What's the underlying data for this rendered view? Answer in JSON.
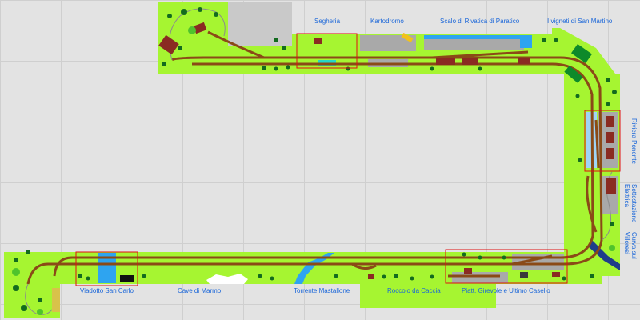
{
  "colors": {
    "board": "#a6f531",
    "track": "#8a4a17",
    "label": "#1a66d9",
    "section_frame": "#e01010",
    "water": "#2ea4f0",
    "building": "#8a2b22",
    "tree": "#136b1f",
    "concrete": "#a9a9a9"
  },
  "labels": {
    "segheria": "Segheria",
    "kartodromo": "Kartodromo",
    "scalo": "Scalo di Rivatica di Paratico",
    "vigneti": "I vigneti di San Martino",
    "riviera": "Riviera Ponente",
    "sottostazione": "Sottostazione Elettrica",
    "curva": "Curva sul Villoresi",
    "viadotto": "Viadotto San Carlo",
    "cave": "Cave di Marmo",
    "torrente": "Torrente Mastallone",
    "roccolo": "Roccolo da Caccia",
    "piatt": "Piatt. Girevole e Ultimo Casello"
  }
}
